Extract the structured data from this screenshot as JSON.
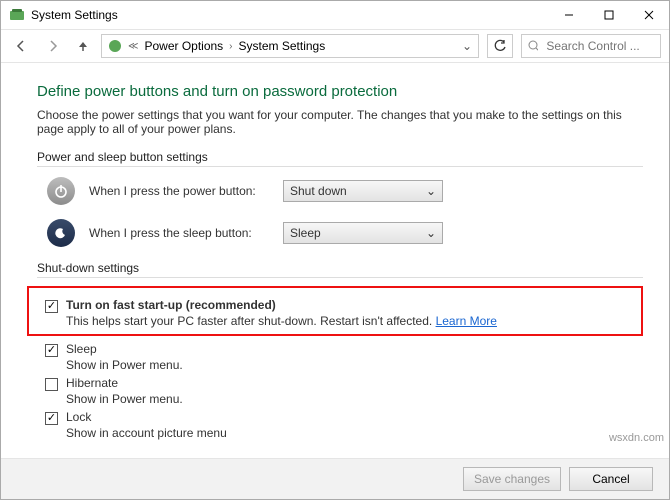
{
  "window": {
    "title": "System Settings"
  },
  "breadcrumb": {
    "level1": "Power Options",
    "level2": "System Settings"
  },
  "search": {
    "placeholder": "Search Control ..."
  },
  "page": {
    "heading": "Define power buttons and turn on password protection",
    "description": "Choose the power settings that you want for your computer. The changes that you make to the settings on this page apply to all of your power plans."
  },
  "buttons_section": {
    "label": "Power and sleep button settings",
    "power": {
      "label": "When I press the power button:",
      "value": "Shut down"
    },
    "sleep": {
      "label": "When I press the sleep button:",
      "value": "Sleep"
    }
  },
  "shutdown_section": {
    "label": "Shut-down settings",
    "fast_startup": {
      "title": "Turn on fast start-up (recommended)",
      "desc": "This helps start your PC faster after shut-down. Restart isn't affected.",
      "link": "Learn More"
    },
    "sleep": {
      "title": "Sleep",
      "desc": "Show in Power menu."
    },
    "hibernate": {
      "title": "Hibernate",
      "desc": "Show in Power menu."
    },
    "lock": {
      "title": "Lock",
      "desc": "Show in account picture menu"
    }
  },
  "footer": {
    "save": "Save changes",
    "cancel": "Cancel"
  },
  "watermark": "wsxdn.com"
}
